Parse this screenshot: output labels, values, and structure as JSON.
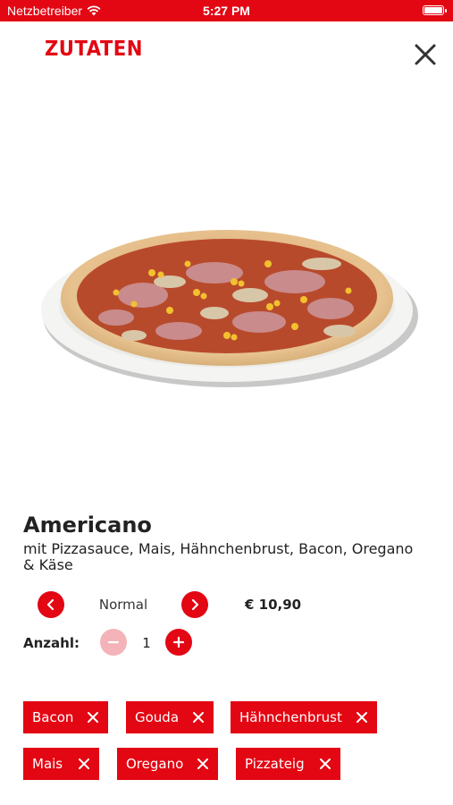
{
  "status_bar": {
    "carrier": "Netzbetreiber",
    "time": "5:27 PM"
  },
  "header": {
    "title": "ZUTATEN"
  },
  "product": {
    "name": "Americano",
    "description": "mit Pizzasauce, Mais, Hähnchenbrust, Bacon, Oregano & Käse"
  },
  "size_selector": {
    "value": "Normal"
  },
  "price": "€ 10,90",
  "quantity": {
    "label": "Anzahl:",
    "value": "1"
  },
  "ingredients": [
    "Bacon",
    "Gouda",
    "Hähnchenbrust",
    "Mais",
    "Oregano",
    "Pizzateig"
  ],
  "colors": {
    "accent": "#e30613",
    "accent_disabled": "#f3b3b8"
  }
}
